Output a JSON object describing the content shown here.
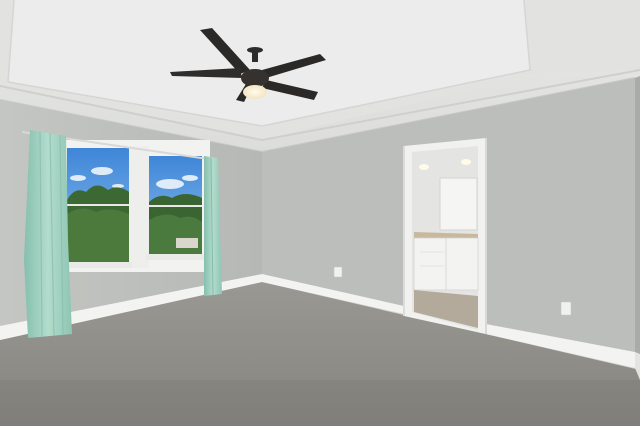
{
  "scene": {
    "kind": "photo",
    "subject": "empty-bedroom-interior"
  },
  "palette": {
    "wall": "#bfc1be",
    "wall_right": "#b8bab6",
    "ceiling": "#e6e7e5",
    "tray_ceiling": "#edeeec",
    "carpet": "#8f8d88",
    "baseboard": "#f4f4f2",
    "curtain": "#9ccdbd",
    "sky": "#4f8fd6",
    "trees": "#3f6b35",
    "fan": "#2e2c2a",
    "light": "#fff6df",
    "bathroom_wall": "#e5e6e4",
    "cabinet": "#f2f2f0",
    "counter": "#c9b9a1"
  }
}
